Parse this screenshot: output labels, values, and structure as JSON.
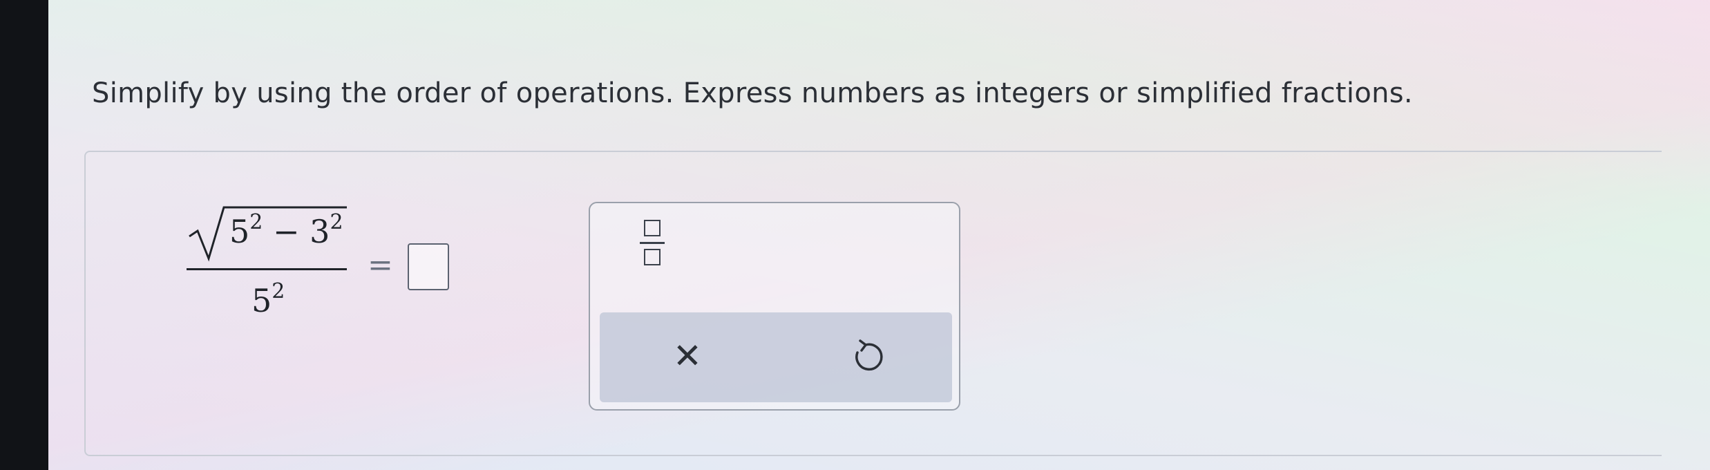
{
  "instruction": "Simplify by using the order of operations. Express numbers as integers or simplified fractions.",
  "expression": {
    "numerator": {
      "radicand_term1_base": "5",
      "radicand_term1_exponent": "2",
      "operator": "−",
      "radicand_term2_base": "3",
      "radicand_term2_exponent": "2"
    },
    "denominator": {
      "base": "5",
      "exponent": "2"
    },
    "equals": "=",
    "answer_value": ""
  },
  "keypad": {
    "keys": [
      {
        "name": "fraction",
        "icon": "fraction-template-icon"
      }
    ],
    "actions": [
      {
        "name": "clear",
        "icon": "close-icon",
        "glyph": "✕"
      },
      {
        "name": "undo",
        "icon": "undo-icon"
      }
    ]
  },
  "colors": {
    "text": "#2b2f36",
    "bezel": "#111317",
    "keypad_action_bar": "#bec4d6",
    "panel_border": "#c9cdd6"
  }
}
